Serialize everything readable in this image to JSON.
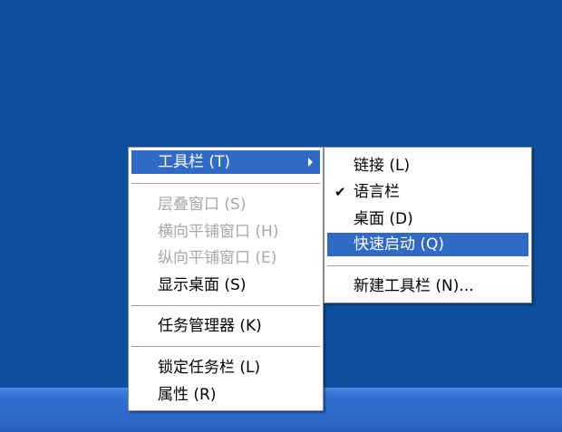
{
  "context_menu": {
    "items": [
      {
        "label": "工具栏 (T)"
      },
      {
        "label": "层叠窗口 (S)"
      },
      {
        "label": "横向平铺窗口 (H)"
      },
      {
        "label": "纵向平铺窗口 (E)"
      },
      {
        "label": "显示桌面 (S)"
      },
      {
        "label": "任务管理器 (K)"
      },
      {
        "label": "锁定任务栏 (L)"
      },
      {
        "label": "属性 (R)"
      }
    ]
  },
  "toolbar_submenu": {
    "items": [
      {
        "label": "链接 (L)"
      },
      {
        "label": "语言栏",
        "checked": true,
        "check_glyph": "✔"
      },
      {
        "label": "桌面 (D)"
      },
      {
        "label": "快速启动 (Q)"
      },
      {
        "label": "新建工具栏 (N)..."
      }
    ]
  },
  "colors": {
    "desktop": "#0b4f9e",
    "highlight": "#316ac5",
    "disabled_text": "#a8a8a8",
    "taskbar": "#2f6fd0"
  }
}
